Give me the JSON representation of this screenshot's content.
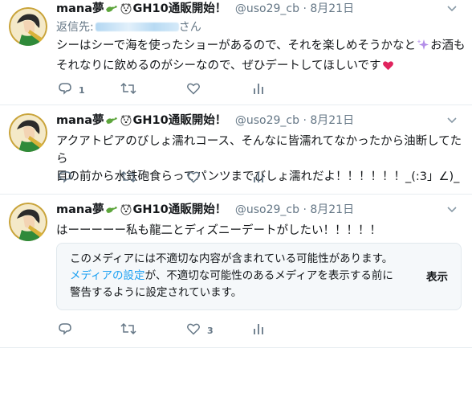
{
  "tweets": [
    {
      "user": {
        "name": "mana夢",
        "name_tail": "GH10通販開始！",
        "handle": "@uso29_cb"
      },
      "separator": "·",
      "date": "8月21日",
      "reply_to_label": "返信先:",
      "reply_to_suffix": "さん",
      "text_line1": "シーはシーで海を使ったショーがあるので、それを楽しめそうかなと",
      "text_line1_tail": "お酒も",
      "text_line2": "それなりに飲めるのがシーなので、ぜひデートしてほしいです",
      "actions": {
        "reply_count": "1",
        "retweet_count": "",
        "like_count": ""
      }
    },
    {
      "user": {
        "name": "mana夢",
        "name_tail": "GH10通販開始！",
        "handle": "@uso29_cb"
      },
      "separator": "·",
      "date": "8月21日",
      "text_line1": "アクアトピアのびしょ濡れコース、そんなに皆濡れてなかったから油断してたら",
      "text_line2": "目の前から水鉄砲食らってパンツまでびしょ濡れだよ！！！！！！_(:3」∠)_",
      "actions": {
        "reply_count": "",
        "retweet_count": "",
        "like_count": ""
      }
    },
    {
      "user": {
        "name": "mana夢",
        "name_tail": "GH10通販開始！",
        "handle": "@uso29_cb"
      },
      "separator": "·",
      "date": "8月21日",
      "text_line1": "はーーーーー私も龍二とディズニーデートがしたい！！！！！",
      "media_warning": {
        "line1": "このメディアには不適切な内容が含まれている可能性があります。",
        "link": "メディアの設定",
        "line2_tail": "が、不適切な可能性のあるメディアを表示する前に",
        "line3": "警告するように設定されています。",
        "show_label": "表示"
      },
      "actions": {
        "reply_count": "",
        "retweet_count": "",
        "like_count": "3"
      }
    }
  ],
  "colors": {
    "text": "#14171a",
    "muted": "#657786",
    "link": "#1da1f2",
    "heart": "#e0245e",
    "divider": "#e6ecf0"
  },
  "icons": [
    "avatar",
    "croc-emoji",
    "dog-emoji",
    "chevron-down-icon",
    "sparkles-emoji",
    "heart-emoji",
    "reply-icon",
    "retweet-icon",
    "like-icon",
    "analytics-icon"
  ]
}
